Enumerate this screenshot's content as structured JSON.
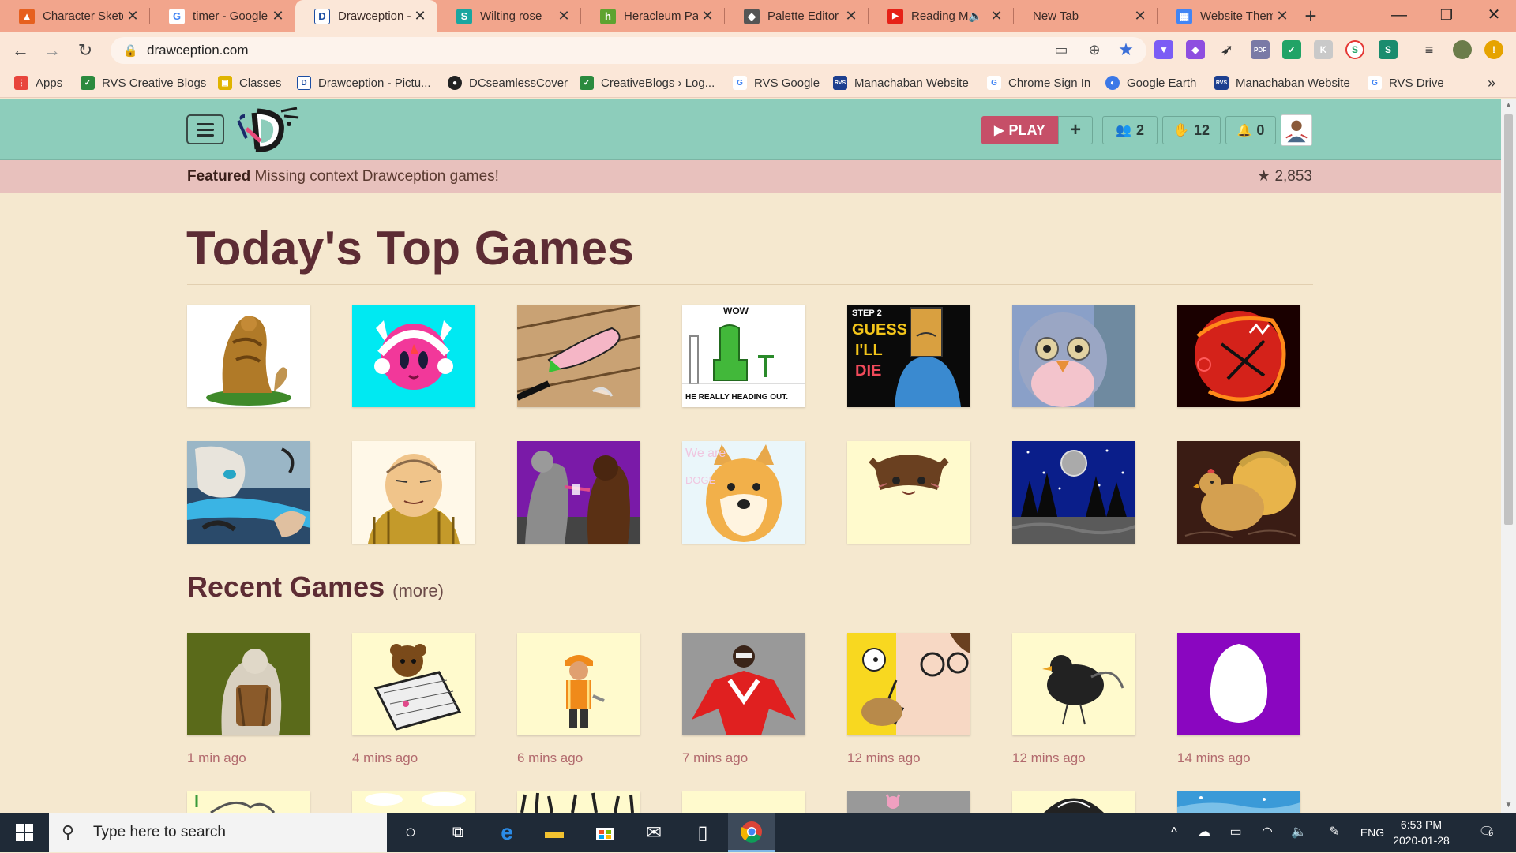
{
  "browser": {
    "tabs": [
      {
        "title": "Character Sketc",
        "icon": "drawing-app-icon",
        "color": "#e6601f",
        "glyph": "▲"
      },
      {
        "title": "timer - Google",
        "icon": "google-icon",
        "color": "#ffffff",
        "glyph": "G"
      },
      {
        "title": "Drawception - I",
        "icon": "drawception-icon",
        "color": "#ffffff",
        "glyph": "D",
        "active": true
      },
      {
        "title": "Wilting rose",
        "icon": "sketchfab-icon",
        "color": "#1aa6a0",
        "glyph": "S"
      },
      {
        "title": "Heracleum Pale",
        "icon": "houzz-icon",
        "color": "#5ea330",
        "glyph": "h"
      },
      {
        "title": "Palette Editor -",
        "icon": "palette-icon",
        "color": "#555555",
        "glyph": "◆"
      },
      {
        "title": "Reading M",
        "icon": "youtube-icon",
        "color": "#e62117",
        "glyph": "▶"
      },
      {
        "title": "New Tab",
        "icon": "",
        "color": "",
        "glyph": ""
      },
      {
        "title": "Website Theme",
        "icon": "sites-icon",
        "color": "#4285f4",
        "glyph": "▦"
      }
    ],
    "new_tab": "+",
    "window_controls": {
      "minimize": "—",
      "maximize": "❐",
      "close": "✕"
    },
    "url": "drawception.com",
    "bookmarks": [
      {
        "label": "Apps",
        "icon": "apps-grid-icon",
        "color": "#e8453c"
      },
      {
        "label": "RVS Creative Blogs",
        "icon": "creative-blogs-icon",
        "color": "#2b8a3e"
      },
      {
        "label": "Classes",
        "icon": "classroom-icon",
        "color": "#e0b400"
      },
      {
        "label": "Drawception - Pictu...",
        "icon": "drawception-icon",
        "color": "#1c4ea3"
      },
      {
        "label": "DCseamlessCover",
        "icon": "github-icon",
        "color": "#222222"
      },
      {
        "label": "CreativeBlogs › Log...",
        "icon": "creative-blogs-icon",
        "color": "#2b8a3e"
      },
      {
        "label": "RVS Google",
        "icon": "google-icon",
        "color": "#4285f4"
      },
      {
        "label": "Manachaban Website",
        "icon": "rvs-icon",
        "color": "#1d3f8f"
      },
      {
        "label": "Chrome Sign In",
        "icon": "google-icon",
        "color": "#4285f4"
      },
      {
        "label": "Google Earth",
        "icon": "google-earth-icon",
        "color": "#3b78e7"
      },
      {
        "label": "Manachaban Website",
        "icon": "rvs-icon",
        "color": "#1d3f8f"
      },
      {
        "label": "RVS Drive",
        "icon": "google-icon",
        "color": "#4285f4"
      }
    ],
    "bookmarks_more": "»"
  },
  "site": {
    "play_label": "PLAY",
    "plus_label": "+",
    "friends_count": "2",
    "likes_count": "12",
    "notifications_count": "0",
    "featured_bold": "Featured",
    "featured_text": "Missing context Drawception games!",
    "stars": "2,853",
    "top_heading": "Today's Top Games",
    "recent_heading": "Recent Games",
    "recent_more": "(more)",
    "thumb_text": {
      "wow": "WOW",
      "heading_out": "HE REALLY HEADING OUT.",
      "step2": "STEP 2",
      "guess": "GUESS",
      "ill": "I'LL",
      "die": "DIE",
      "we_are": "We are",
      "doge": "DOGE"
    },
    "recent_times": [
      "1 min ago",
      "4 mins ago",
      "6 mins ago",
      "7 mins ago",
      "12 mins ago",
      "12 mins ago",
      "14 mins ago"
    ]
  },
  "taskbar": {
    "search_placeholder": "Type here to search",
    "language": "ENG",
    "time": "6:53 PM",
    "date": "2020-01-28",
    "notifications": "6"
  },
  "colors": {
    "header_teal": "#8dcdbb",
    "featured_pink": "#e8c1bd",
    "page_bg": "#f5e8cf",
    "heading": "#5d2c34",
    "play_button": "#c64f68",
    "tabstrip": "#f2a58c"
  }
}
